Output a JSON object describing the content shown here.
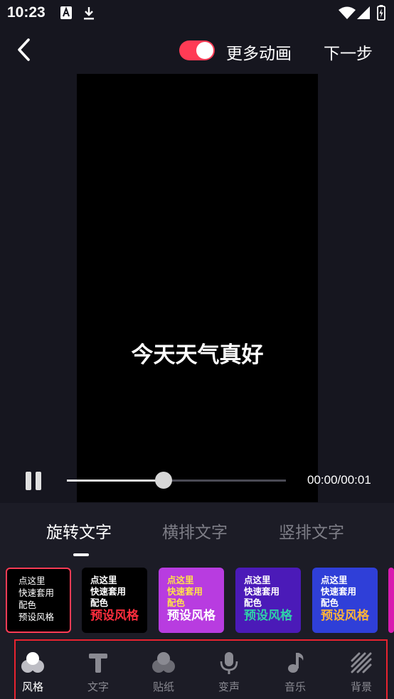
{
  "status_bar": {
    "time": "10:23"
  },
  "top_bar": {
    "more_anim_label": "更多动画",
    "more_anim_on": true,
    "next_label": "下一步"
  },
  "preview": {
    "text": "今天天气真好"
  },
  "player": {
    "time": "00:00/00:01",
    "progress": 0.44
  },
  "tabs": [
    {
      "label": "旋转文字",
      "active": true
    },
    {
      "label": "横排文字",
      "active": false
    },
    {
      "label": "竖排文字",
      "active": false
    }
  ],
  "style_cards": [
    {
      "lines": [
        "点这里",
        "快速套用",
        "配色",
        "预设风格"
      ],
      "bg": "#000000",
      "selected": true
    },
    {
      "lines": [
        "点这里",
        "快速套用",
        "配色"
      ],
      "big": "预设风格",
      "bg": "#000000",
      "text_color": "#ffffff",
      "accent": "#ff2d3d"
    },
    {
      "lines": [
        "点这里",
        "快速套用",
        "配色"
      ],
      "big": "预设风格",
      "bg": "#b83ce0",
      "text_color": "#ffe14a",
      "accent": "#ffffff"
    },
    {
      "lines": [
        "点这里",
        "快速套用",
        "配色"
      ],
      "big": "预设风格",
      "bg": "#4b1ab8",
      "text_color": "#ffffff",
      "accent": "#2fd0a8"
    },
    {
      "lines": [
        "点这里",
        "快速套用",
        "配色"
      ],
      "big": "预设风格",
      "bg": "#2f3fd8",
      "text_color": "#ffffff",
      "accent": "#ffb43a"
    }
  ],
  "bottom_nav": [
    {
      "label": "风格",
      "icon": "style-circles-icon",
      "active": true
    },
    {
      "label": "文字",
      "icon": "text-t-icon",
      "active": false
    },
    {
      "label": "贴纸",
      "icon": "sticker-circles-icon",
      "active": false
    },
    {
      "label": "变声",
      "icon": "microphone-icon",
      "active": false
    },
    {
      "label": "音乐",
      "icon": "music-note-icon",
      "active": false
    },
    {
      "label": "背景",
      "icon": "background-stripes-icon",
      "active": false
    }
  ],
  "colors": {
    "accent": "#ff3b55",
    "highlight_border": "#e8232f"
  }
}
